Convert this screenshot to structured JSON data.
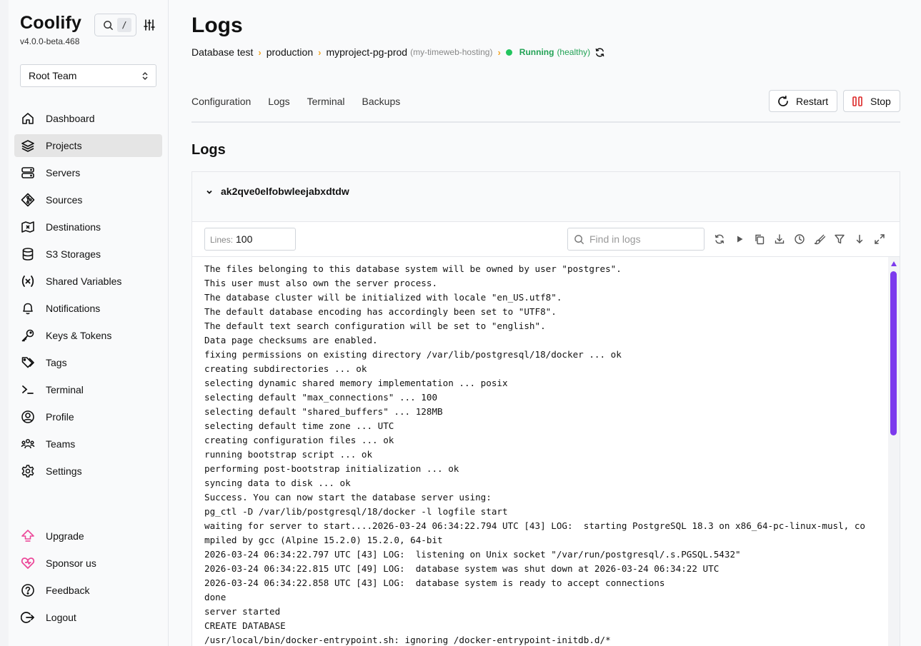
{
  "app": {
    "name": "Coolify",
    "version": "v4.0.0-beta.468",
    "search_shortcut": "/"
  },
  "team": {
    "selected": "Root Team"
  },
  "sidebar": {
    "items": [
      {
        "label": "Dashboard",
        "icon": "home-icon",
        "active": false
      },
      {
        "label": "Projects",
        "icon": "layers-icon",
        "active": true
      },
      {
        "label": "Servers",
        "icon": "server-icon",
        "active": false
      },
      {
        "label": "Sources",
        "icon": "git-icon",
        "active": false
      },
      {
        "label": "Destinations",
        "icon": "destination-icon",
        "active": false
      },
      {
        "label": "S3 Storages",
        "icon": "database-icon",
        "active": false
      },
      {
        "label": "Shared Variables",
        "icon": "variable-icon",
        "active": false
      },
      {
        "label": "Notifications",
        "icon": "bell-icon",
        "active": false
      },
      {
        "label": "Keys & Tokens",
        "icon": "key-icon",
        "active": false
      },
      {
        "label": "Tags",
        "icon": "tag-icon",
        "active": false
      },
      {
        "label": "Terminal",
        "icon": "terminal-icon",
        "active": false
      },
      {
        "label": "Profile",
        "icon": "user-circle-icon",
        "active": false
      },
      {
        "label": "Teams",
        "icon": "users-icon",
        "active": false
      },
      {
        "label": "Settings",
        "icon": "gear-icon",
        "active": false
      }
    ],
    "bottom_items": [
      {
        "label": "Upgrade",
        "icon": "upgrade-arrow-icon"
      },
      {
        "label": "Sponsor us",
        "icon": "heart-icon"
      },
      {
        "label": "Feedback",
        "icon": "help-circle-icon"
      },
      {
        "label": "Logout",
        "icon": "logout-icon"
      }
    ]
  },
  "page": {
    "title": "Logs",
    "breadcrumb": {
      "project": "Database test",
      "environment": "production",
      "resource": "myproject-pg-prod",
      "server": "(my-timeweb-hosting)",
      "status": "Running",
      "health": "(healthy)"
    },
    "tabs": [
      "Configuration",
      "Logs",
      "Terminal",
      "Backups"
    ],
    "actions": {
      "restart": "Restart",
      "stop": "Stop"
    },
    "section_title": "Logs",
    "container": {
      "name": "ak2qve0elfobwleejabxdtdw",
      "lines_label": "Lines:",
      "lines_value": "100",
      "find_placeholder": "Find in logs",
      "log_lines": [
        "The files belonging to this database system will be owned by user \"postgres\".",
        "This user must also own the server process.",
        "The database cluster will be initialized with locale \"en_US.utf8\".",
        "The default database encoding has accordingly been set to \"UTF8\".",
        "The default text search configuration will be set to \"english\".",
        "Data page checksums are enabled.",
        "fixing permissions on existing directory /var/lib/postgresql/18/docker ... ok",
        "creating subdirectories ... ok",
        "selecting dynamic shared memory implementation ... posix",
        "selecting default \"max_connections\" ... 100",
        "selecting default \"shared_buffers\" ... 128MB",
        "selecting default time zone ... UTC",
        "creating configuration files ... ok",
        "running bootstrap script ... ok",
        "performing post-bootstrap initialization ... ok",
        "syncing data to disk ... ok",
        "Success. You can now start the database server using:",
        "pg_ctl -D /var/lib/postgresql/18/docker -l logfile start",
        "waiting for server to start....2026-03-24 06:34:22.794 UTC [43] LOG:  starting PostgreSQL 18.3 on x86_64-pc-linux-musl, co",
        "mpiled by gcc (Alpine 15.2.0) 15.2.0, 64-bit",
        "2026-03-24 06:34:22.797 UTC [43] LOG:  listening on Unix socket \"/var/run/postgresql/.s.PGSQL.5432\"",
        "2026-03-24 06:34:22.815 UTC [49] LOG:  database system was shut down at 2026-03-24 06:34:22 UTC",
        "2026-03-24 06:34:22.858 UTC [43] LOG:  database system is ready to accept connections",
        "done",
        "server started",
        "CREATE DATABASE",
        "/usr/local/bin/docker-entrypoint.sh: ignoring /docker-entrypoint-initdb.d/*"
      ]
    }
  },
  "colors": {
    "accent": "#7c3aed",
    "breadcrumb_separator": "#f5a623",
    "status_running": "#22a255",
    "stop_icon": "#dc2626",
    "upgrade_icon": "#ec4899"
  }
}
